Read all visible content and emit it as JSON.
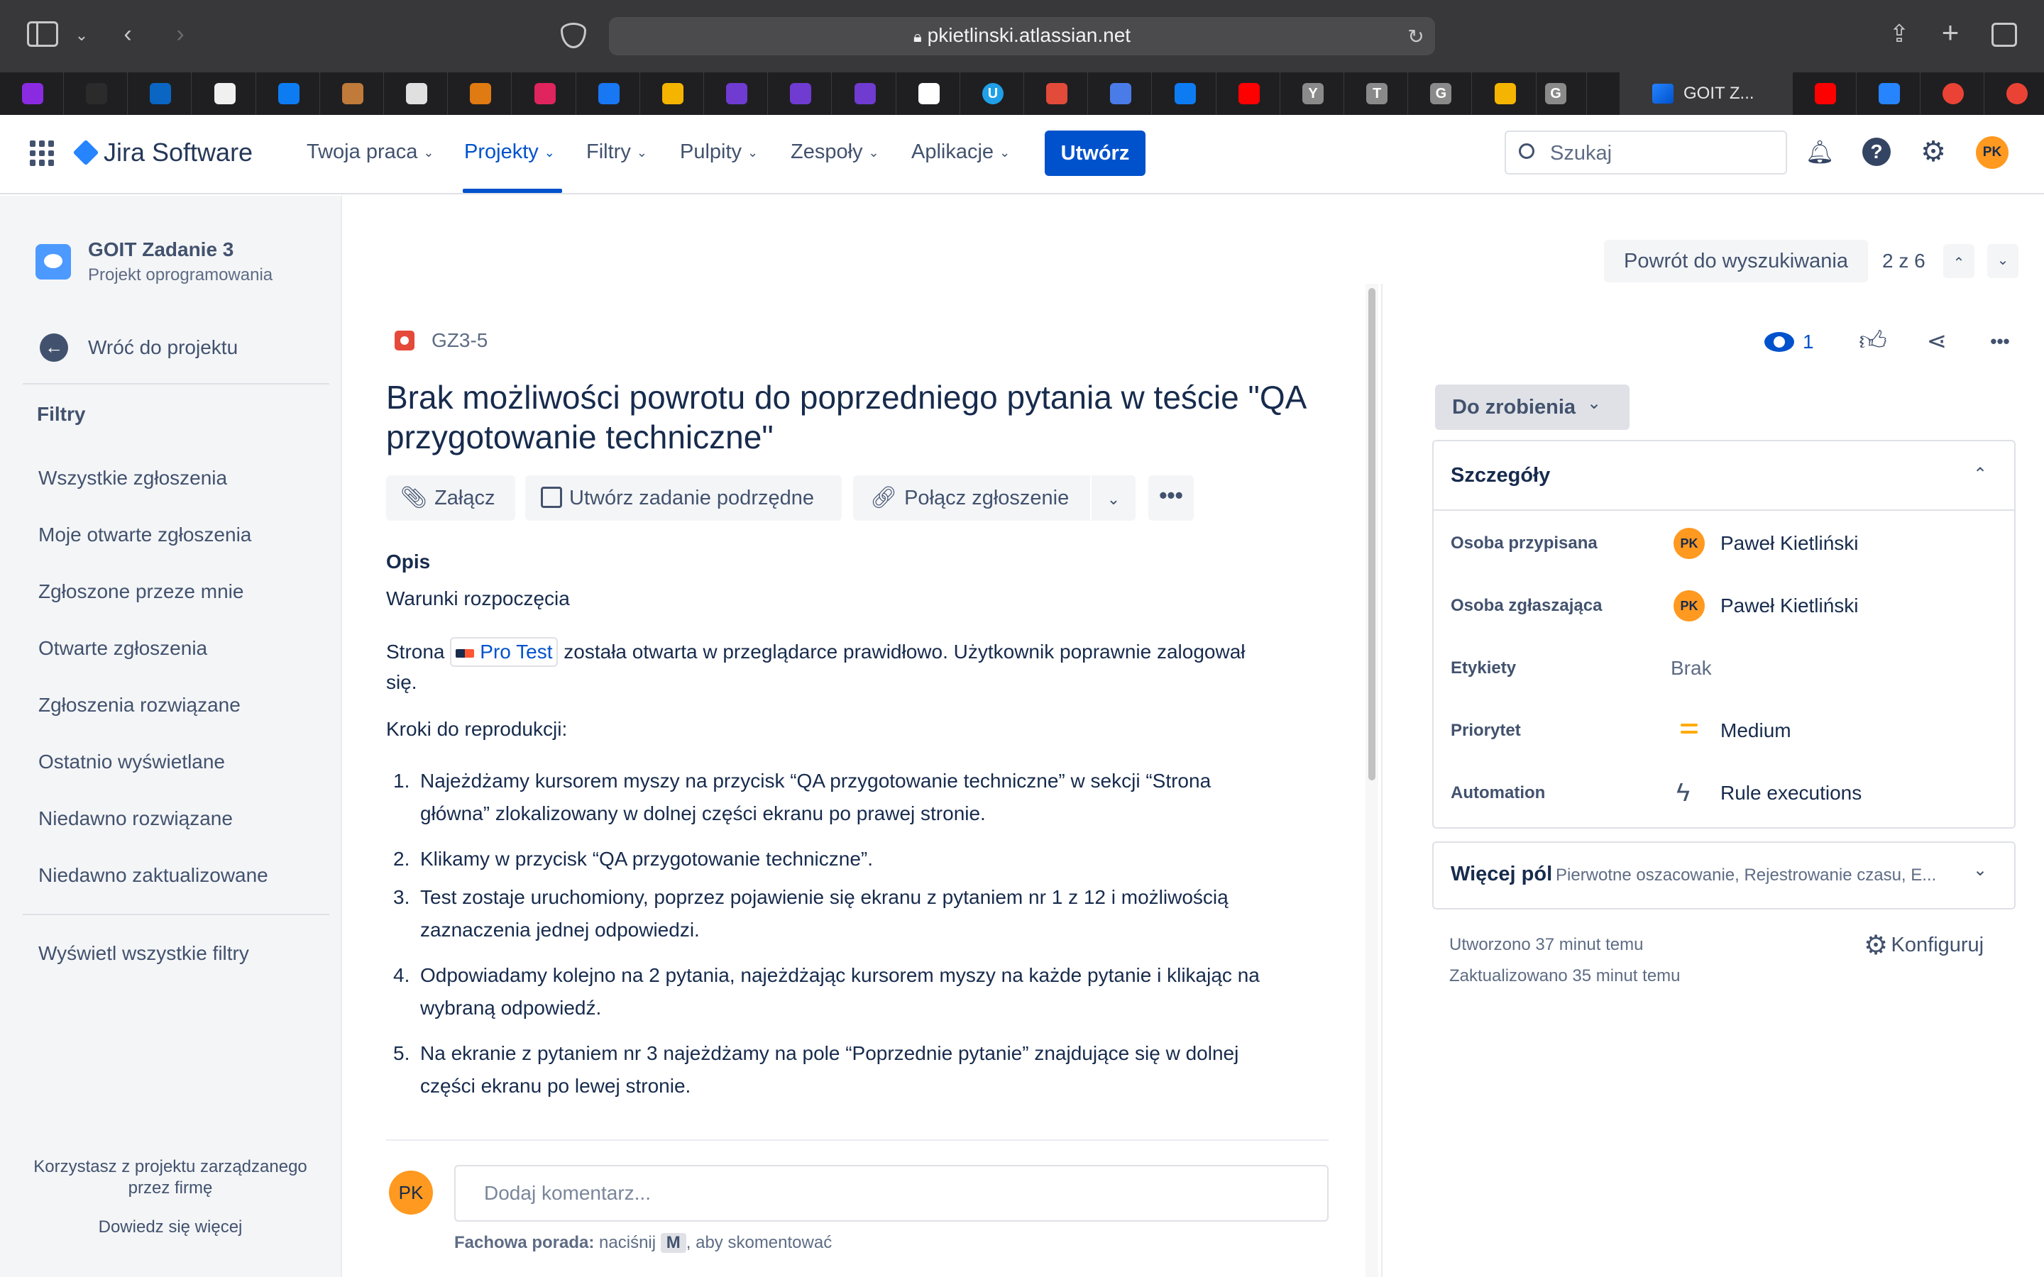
{
  "browser": {
    "url": "pkietlinski.atlassian.net",
    "active_tab": "GOIT Z...",
    "favicons": [
      "u-icon",
      "gear-icon",
      "linkedin-icon",
      "github-icon",
      "p-icon",
      "image-icon",
      "book-icon",
      "triangle-icon",
      "hub-icon",
      "facebook-icon",
      "star-icon",
      "v-icon",
      "v-icon",
      "v-icon",
      "m-icon",
      "u-circle-icon",
      "openai-icon",
      "translate-icon",
      "p-icon",
      "youtube-icon",
      "y-icon",
      "t-icon",
      "g-icon",
      "bolt-icon",
      "g-icon"
    ],
    "favicon_labels": {
      "y": "Y",
      "t": "T",
      "g": "G",
      "u": "U"
    }
  },
  "nav": {
    "logo": "Jira Software",
    "items": [
      "Twoja praca",
      "Projekty",
      "Filtry",
      "Pulpity",
      "Zespoły",
      "Aplikacje"
    ],
    "create": "Utwórz",
    "search_placeholder": "Szukaj",
    "avatar": "PK"
  },
  "sidebar": {
    "project_name": "GOIT Zadanie 3",
    "project_type": "Projekt oprogramowania",
    "back": "Wróć do projektu",
    "filters_heading": "Filtry",
    "filters": [
      "Wszystkie zgłoszenia",
      "Moje otwarte zgłoszenia",
      "Zgłoszone przeze mnie",
      "Otwarte zgłoszenia",
      "Zgłoszenia rozwiązane",
      "Ostatnio wyświetlane",
      "Niedawno rozwiązane",
      "Niedawno zaktualizowane"
    ],
    "view_all": "Wyświetl wszystkie filtry",
    "footer_line1": "Korzystasz z projektu zarządzanego",
    "footer_line2": "przez firmę",
    "learn_more": "Dowiedz się więcej"
  },
  "issue": {
    "back_to_search": "Powrót do wyszukiwania",
    "position": "2 z 6",
    "key": "GZ3-5",
    "title_line1": "Brak możliwości powrotu do poprzedniego pytania w teście \"QA",
    "title_line2": "przygotowanie techniczne\"",
    "actions": {
      "attach": "Załącz",
      "subtask": "Utwórz zadanie podrzędne",
      "link": "Połącz zgłoszenie"
    },
    "watchers": "1",
    "description_heading": "Opis",
    "preconditions": "Warunki rozpoczęcia",
    "para_before": "Strona",
    "link_text": "Pro Test",
    "para_after": "została otwarta w przeglądarce prawidłowo. Użytkownik poprawnie zalogował",
    "para_cont": "się.",
    "steps_heading": "Kroki do reprodukcji:",
    "steps": [
      {
        "n": "1.",
        "l1": "Najeżdżamy kursorem myszy na przycisk “QA przygotowanie techniczne” w sekcji “Strona",
        "l2": "główna” zlokalizowany w dolnej części ekranu po prawej stronie."
      },
      {
        "n": "2.",
        "l1": "Klikamy w przycisk “QA przygotowanie techniczne”.",
        "l2": ""
      },
      {
        "n": "3.",
        "l1": "Test zostaje uruchomiony, poprzez pojawienie się ekranu z pytaniem nr 1 z 12 i możliwością",
        "l2": "zaznaczenia jednej odpowiedzi."
      },
      {
        "n": "4.",
        "l1": "Odpowiadamy kolejno na 2 pytania, najeżdżając kursorem myszy na każde pytanie i klikając na",
        "l2": "wybraną odpowiedź."
      },
      {
        "n": "5.",
        "l1": "Na ekranie z pytaniem nr 3 najeżdżamy na pole “Poprzednie pytanie” znajdujące się w dolnej",
        "l2": "części ekranu po lewej stronie."
      }
    ],
    "comment_placeholder": "Dodaj komentarz...",
    "tip_bold": "Fachowa porada:",
    "tip_press": "naciśnij",
    "tip_key": "M",
    "tip_rest": ", aby skomentować",
    "commenter": "PK"
  },
  "details": {
    "status": "Do zrobienia",
    "heading": "Szczegóły",
    "assignee_label": "Osoba przypisana",
    "assignee": "Paweł Kietliński",
    "reporter_label": "Osoba zgłaszająca",
    "reporter": "Paweł Kietliński",
    "labels_label": "Etykiety",
    "labels": "Brak",
    "priority_label": "Priorytet",
    "priority": "Medium",
    "automation_label": "Automation",
    "automation": "Rule executions",
    "more_fields": "Więcej pól",
    "more_fields_hint": "Pierwotne oszacowanie, Rejestrowanie czasu, E...",
    "created": "Utworzono 37 minut temu",
    "updated": "Zaktualizowano 35 minut temu",
    "configure": "Konfiguruj",
    "avatar": "PK"
  },
  "colors": {
    "accent": "#0052cc",
    "avatar": "#ff991f",
    "bug": "#e5493a"
  }
}
